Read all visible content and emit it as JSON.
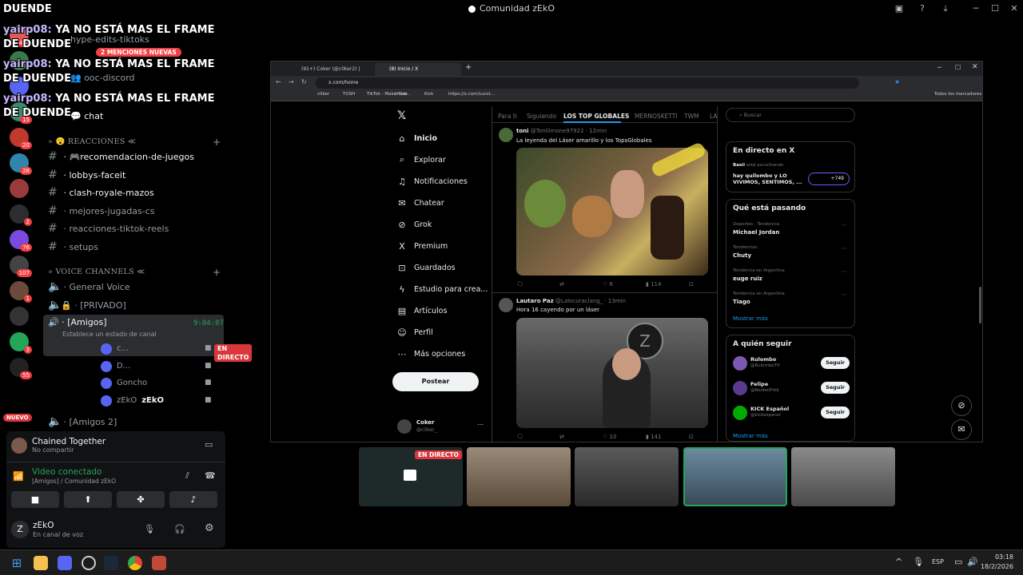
{
  "window": {
    "title": "Comunidad zEkO"
  },
  "overlay_chat": [
    {
      "user": "yairp08:",
      "text": "YA NO ESTÁ MAS EL FRAME DE DUENDE"
    },
    {
      "user": "yairp08:",
      "text": "YA NO ESTÁ MAS EL FRAME DE DUENDE"
    },
    {
      "user": "yairp08:",
      "text": "YA NO ESTÁ MAS EL FRAME DE DUENDE"
    }
  ],
  "overlay_top": "DUENDE",
  "mentions_badge": "2 MENCIONES NUEVAS",
  "servers": [
    {
      "badge": "444"
    },
    {
      "badge": ""
    },
    {
      "badge": ""
    },
    {
      "badge": "15"
    },
    {
      "badge": "20"
    },
    {
      "badge": "28"
    },
    {
      "badge": ""
    },
    {
      "badge": "2"
    },
    {
      "badge": "76"
    },
    {
      "badge": "107"
    },
    {
      "badge": "1"
    },
    {
      "badge": ""
    },
    {
      "badge": "3"
    },
    {
      "badge": "55"
    }
  ],
  "new_badge": "NUEVO",
  "channels_top": [
    {
      "name": "hype-edits-tiktoks"
    },
    {
      "name": "ooc-discord"
    },
    {
      "name": "chat"
    }
  ],
  "category_reactions": "REACCIONES ≪",
  "channels_reactions": [
    {
      "name": "🎮recomendacion-de-juegos",
      "bright": true
    },
    {
      "name": "lobbys-faceit",
      "bright": true
    },
    {
      "name": "clash-royale-mazos",
      "bright": true
    },
    {
      "name": "mejores-jugadas-cs",
      "bright": false
    },
    {
      "name": "reacciones-tiktok-reels",
      "bright": false
    },
    {
      "name": "setups",
      "bright": false
    }
  ],
  "category_voice": "VOICE CHANNELS ≪",
  "voice_channels": [
    {
      "name": "General Voice"
    },
    {
      "name": "[PRIVADO]"
    },
    {
      "name": "[Amigos]",
      "timer": "9:04:07",
      "status": "Establece un estado de canal"
    },
    {
      "name": "[Amigos 2]"
    }
  ],
  "voice_users": [
    {
      "name": "c...",
      "live": "EN DIRECTO"
    },
    {
      "name": "D..."
    },
    {
      "name": "Goncho"
    },
    {
      "name": "zEkO",
      "tag": "zEkO"
    }
  ],
  "activity": {
    "title": "Chained Together",
    "sub": "No compartir"
  },
  "connection": {
    "title": "Video conectado",
    "sub": "[Amigos] / Comunidad zEkO"
  },
  "user": {
    "name": "zEkO",
    "status": "En canal de voz"
  },
  "browser": {
    "tabs": [
      "(91+) Coker (@c0ker2) | TikTok",
      "(8) Inicio / X"
    ],
    "url": "x.com/home",
    "bookmarks": [
      "c0ker",
      "TOSH",
      "TikTok - Make Your...",
      "Inicio",
      "Kick",
      "https://x.com/Lucst..."
    ],
    "all_bookmarks": "Todos los marcadores"
  },
  "x": {
    "nav": [
      {
        "icon": "home-icon",
        "glyph": "⌂",
        "label": "Inicio"
      },
      {
        "icon": "search-icon",
        "glyph": "⌕",
        "label": "Explorar"
      },
      {
        "icon": "bell-icon",
        "glyph": "♫",
        "label": "Notificaciones"
      },
      {
        "icon": "mail-icon",
        "glyph": "✉",
        "label": "Chatear"
      },
      {
        "icon": "grok-icon",
        "glyph": "⊘",
        "label": "Grok"
      },
      {
        "icon": "x-icon",
        "glyph": "X",
        "label": "Premium"
      },
      {
        "icon": "bookmark-icon",
        "glyph": "⊡",
        "label": "Guardados"
      },
      {
        "icon": "bolt-icon",
        "glyph": "ϟ",
        "label": "Estudio para crea..."
      },
      {
        "icon": "article-icon",
        "glyph": "▤",
        "label": "Artículos"
      },
      {
        "icon": "person-icon",
        "glyph": "☺",
        "label": "Perfil"
      },
      {
        "icon": "dots-icon",
        "glyph": "⋯",
        "label": "Más opciones"
      }
    ],
    "post": "Postear",
    "profile": {
      "name": "Coker",
      "handle": "@c0ker_"
    },
    "tabs": [
      "Para ti",
      "Siguiendo",
      "LOS TOP GLOBALES",
      "MERNOSKETTI",
      "TWM",
      "LA"
    ],
    "tweets": [
      {
        "name": "toni",
        "handle": "@Tonilimone97922 · 12min",
        "text": "La leyenda del Láser amarillo y los TopsGlobales",
        "stats": {
          "likes": "6",
          "views": "114"
        }
      },
      {
        "name": "Lautaro Paz",
        "handle": "@Lalocuraclang_ · 13min",
        "text": "Hora 16 cayendo por un láser",
        "stats": {
          "likes": "10",
          "views": "141"
        }
      }
    ],
    "search": "Buscar",
    "live": {
      "title": "En directo en X",
      "host": "Basil",
      "host_note": "está escuchando",
      "text": "hay quilombo y LO VIVIMOS, SENTIMOS, ...",
      "count": "+749"
    },
    "trends": {
      "title": "Qué está pasando",
      "items": [
        {
          "cat": "Deportes · Tendencia",
          "name": "Michael Jordan"
        },
        {
          "cat": "Tendencias",
          "name": "Chuty"
        },
        {
          "cat": "Tendencia en Argentina",
          "name": "euge ruiz"
        },
        {
          "cat": "Tendencia en Argentina",
          "name": "Tiago"
        }
      ],
      "more": "Mostrar más"
    },
    "follow": {
      "title": "A quién seguir",
      "items": [
        {
          "name": "Rulombo",
          "handle": "@RulomboTV",
          "btn": "Seguir"
        },
        {
          "name": "Felipe",
          "handle": "@RoobetFelk",
          "btn": "Seguir"
        },
        {
          "name": "KICK Español",
          "handle": "@kickespanol",
          "btn": "Seguir"
        }
      ],
      "more": "Mostrar más"
    }
  },
  "stream_thumbs": {
    "live": "EN DIRECTO"
  },
  "taskbar": {
    "lang": "ESP",
    "time": "03:18",
    "date": "18/2/2026"
  }
}
